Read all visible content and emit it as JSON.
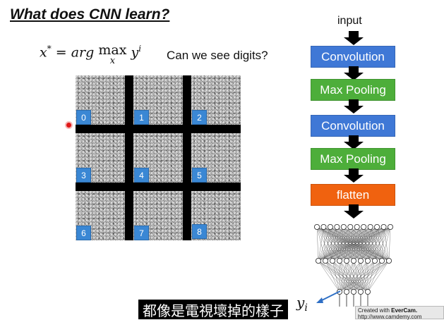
{
  "slide": {
    "title": "What does CNN learn?",
    "formula": {
      "lhs": "x",
      "lhs_sup": "*",
      "eq": " = ",
      "op": "arg",
      "max": "max",
      "max_sub": "x",
      "y": "y",
      "y_sup": "i"
    },
    "question": "Can we see digits?"
  },
  "digit_grid": {
    "labels": [
      "0",
      "1",
      "2",
      "3",
      "4",
      "5",
      "6",
      "7",
      "8"
    ],
    "label_color": "#3a87d4"
  },
  "architecture": {
    "input_label": "input",
    "blocks": [
      {
        "label": "Convolution",
        "color": "#3f78d6"
      },
      {
        "label": "Max Pooling",
        "color": "#4dae3a"
      },
      {
        "label": "Convolution",
        "color": "#3f78d6"
      },
      {
        "label": "Max Pooling",
        "color": "#4dae3a"
      },
      {
        "label": "flatten",
        "color": "#f0620f"
      }
    ],
    "output_label": "y",
    "output_sub": "i"
  },
  "caption": "都像是電視壞掉的樣子",
  "watermark": {
    "line1_prefix": "Created with ",
    "line1_brand": "EverCam.",
    "line2": "http://www.camdemy.com"
  }
}
